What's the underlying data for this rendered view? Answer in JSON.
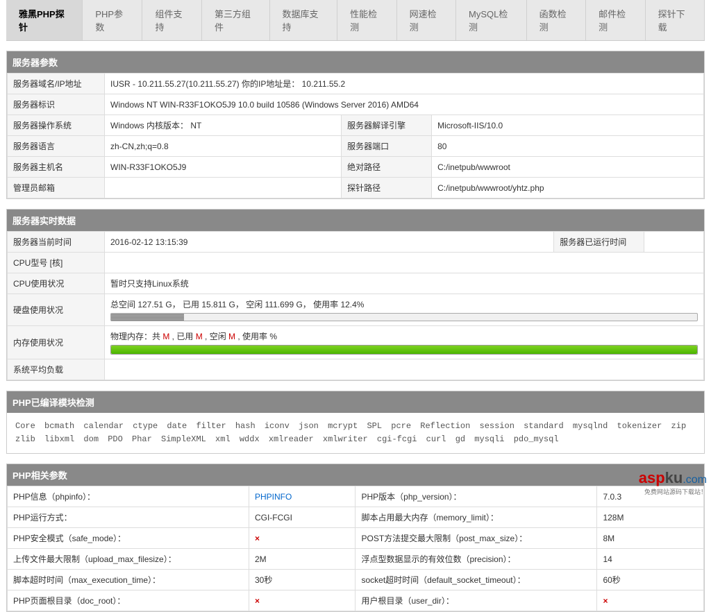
{
  "tabs": {
    "t0": "雅黑PHP探针",
    "t1": "PHP参数",
    "t2": "组件支持",
    "t3": "第三方组件",
    "t4": "数据库支持",
    "t5": "性能检测",
    "t6": "网速检测",
    "t7": "MySQL检测",
    "t8": "函数检测",
    "t9": "邮件检测",
    "t10": "探针下载"
  },
  "server_params": {
    "title": "服务器参数",
    "domain_label": "服务器域名/IP地址",
    "domain_value": "IUSR - 10.211.55.27(10.211.55.27)  你的IP地址是： 10.211.55.2",
    "id_label": "服务器标识",
    "id_value": "Windows NT WIN-R33F1OKO5J9 10.0 build 10586 (Windows Server 2016) AMD64",
    "os_label": "服务器操作系统",
    "os_value": "Windows  内核版本： NT",
    "engine_label": "服务器解译引擎",
    "engine_value": "Microsoft-IIS/10.0",
    "lang_label": "服务器语言",
    "lang_value": "zh-CN,zh;q=0.8",
    "port_label": "服务器端口",
    "port_value": "80",
    "host_label": "服务器主机名",
    "host_value": "WIN-R33F1OKO5J9",
    "abspath_label": "绝对路径",
    "abspath_value": "C:/inetpub/wwwroot",
    "admin_label": "管理员邮箱",
    "admin_value": "",
    "probe_label": "探针路径",
    "probe_value": "C:/inetpub/wwwroot/yhtz.php"
  },
  "realtime": {
    "title": "服务器实时数据",
    "time_label": "服务器当前时间",
    "time_value": "2016-02-12 13:15:39",
    "uptime_label": "服务器已运行时间",
    "uptime_value": "",
    "cpu_model_label": "CPU型号 [核]",
    "cpu_model_value": "",
    "cpu_usage_label": "CPU使用状况",
    "cpu_usage_value": "暂时只支持Linux系统",
    "disk_label": "硬盘使用状况",
    "disk_text": {
      "p1": "总空间 127.51 G， 已用 15.811 G， 空闲 111.699 G， 使用率 12.4%"
    },
    "disk_pct": 12.4,
    "mem_label": "内存使用状况",
    "mem_text": {
      "p1": "物理内存：共 ",
      "m1": "M",
      "p2": " , 已用 ",
      "m2": "M",
      "p3": " , 空闲 ",
      "m3": "M",
      "p4": " , 使用率 %"
    },
    "mem_pct": 100,
    "load_label": "系统平均负载",
    "load_value": ""
  },
  "modules": {
    "title": "PHP已编译模块检测",
    "list": "Core  bcmath  calendar  ctype  date  filter  hash  iconv  json  mcrypt  SPL  pcre  Reflection  session  standard  mysqlnd  tokenizer  zip  zlib  libxml  dom  PDO  Phar  SimpleXML  xml  wddx  xmlreader  xmlwriter  cgi-fcgi  curl  gd  mysqli  pdo_mysql"
  },
  "php_params": {
    "title": "PHP相关参数",
    "r1k": "PHP信息（phpinfo）：",
    "r1v": "PHPINFO",
    "r1k2": "PHP版本（php_version）：",
    "r1v2": "7.0.3",
    "r2k": "PHP运行方式：",
    "r2v": "CGI-FCGI",
    "r2k2": "脚本占用最大内存（memory_limit）：",
    "r2v2": "128M",
    "r3k": "PHP安全模式（safe_mode）：",
    "r3v": "×",
    "r3k2": "POST方法提交最大限制（post_max_size）：",
    "r3v2": "8M",
    "r4k": "上传文件最大限制（upload_max_filesize）：",
    "r4v": "2M",
    "r4k2": "浮点型数据显示的有效位数（precision）：",
    "r4v2": "14",
    "r5k": "脚本超时时间（max_execution_time）：",
    "r5v": "30秒",
    "r5k2": "socket超时时间（default_socket_timeout）：",
    "r5v2": "60秒",
    "r6k": "PHP页面根目录（doc_root）：",
    "r6v": "×",
    "r6k2": "用户根目录（user_dir）：",
    "r6v2": "×"
  },
  "watermark": {
    "a": "asp",
    "b": "ku",
    "c": ".com",
    "sub": "免费网站源码下载站！"
  }
}
